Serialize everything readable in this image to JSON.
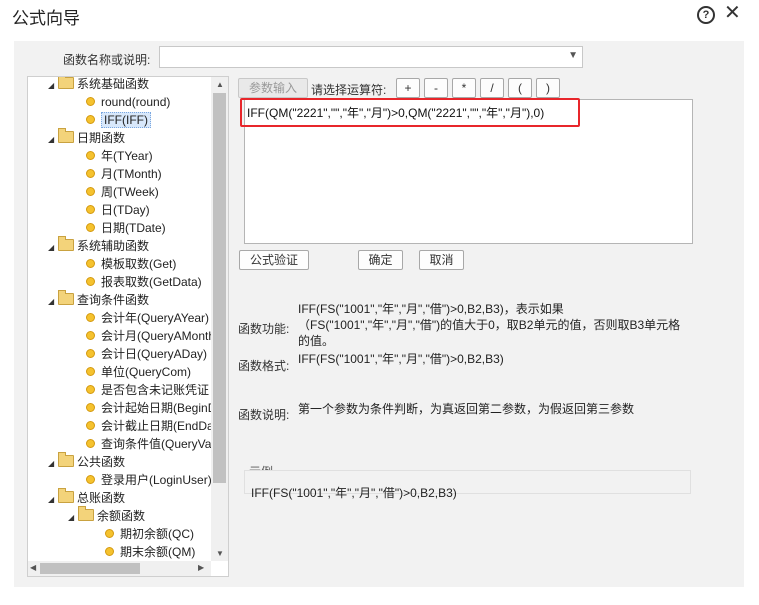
{
  "window": {
    "title": "公式向导",
    "help_icon": "question-circle-icon",
    "close_icon": "close-x-icon"
  },
  "function_select": {
    "label": "函数名称或说明:",
    "value": ""
  },
  "tree": [
    {
      "type": "folder",
      "label": "系统基础函数"
    },
    {
      "type": "leaf",
      "label": "round(round)"
    },
    {
      "type": "leaf",
      "label": "IFF(IFF)",
      "selected": true
    },
    {
      "type": "folder",
      "label": "日期函数"
    },
    {
      "type": "leaf",
      "label": "年(TYear)"
    },
    {
      "type": "leaf",
      "label": "月(TMonth)"
    },
    {
      "type": "leaf",
      "label": "周(TWeek)"
    },
    {
      "type": "leaf",
      "label": "日(TDay)"
    },
    {
      "type": "leaf",
      "label": "日期(TDate)"
    },
    {
      "type": "folder",
      "label": "系统辅助函数"
    },
    {
      "type": "leaf",
      "label": "模板取数(Get)"
    },
    {
      "type": "leaf",
      "label": "报表取数(GetData)"
    },
    {
      "type": "folder",
      "label": "查询条件函数"
    },
    {
      "type": "leaf",
      "label": "会计年(QueryAYear)"
    },
    {
      "type": "leaf",
      "label": "会计月(QueryAMonth)"
    },
    {
      "type": "leaf",
      "label": "会计日(QueryADay)"
    },
    {
      "type": "leaf",
      "label": "单位(QueryCom)"
    },
    {
      "type": "leaf",
      "label": "是否包含未记账凭证"
    },
    {
      "type": "leaf",
      "label": "会计起始日期(BeginDate)"
    },
    {
      "type": "leaf",
      "label": "会计截止日期(EndDate)"
    },
    {
      "type": "leaf",
      "label": "查询条件值(QueryValue)"
    },
    {
      "type": "folder",
      "label": "公共函数"
    },
    {
      "type": "leaf",
      "label": "登录用户(LoginUser)"
    },
    {
      "type": "folder",
      "label": "总账函数"
    },
    {
      "type": "folder2",
      "label": "余额函数"
    },
    {
      "type": "leaf2",
      "label": "期初余额(QC)"
    },
    {
      "type": "leaf2",
      "label": "期末余额(QM)"
    }
  ],
  "toolbar": {
    "param_input": "参数输入",
    "op_label": "请选择运算符:",
    "operators": [
      "+",
      "-",
      "*",
      "/",
      "(",
      ")"
    ]
  },
  "editor": {
    "formula": "IFF(QM(\"2221\",\"\",\"年\",\"月\")>0,QM(\"2221\",\"\",\"年\",\"月\"),0)"
  },
  "actions": {
    "verify": "公式验证",
    "ok": "确定",
    "cancel": "取消"
  },
  "info": {
    "func_label": "函数功能:",
    "func_text": "IFF(FS(\"1001\",\"年\",\"月\",\"借\")>0,B2,B3)，表示如果（FS(\"1001\",\"年\",\"月\",\"借\")的值大于0，取B2单元的值，否则取B3单元格的值。",
    "format_label": "函数格式:",
    "format_text": "IFF(FS(\"1001\",\"年\",\"月\",\"借\")>0,B2,B3)",
    "desc_label": "函数说明:",
    "desc_text": "第一个参数为条件判断，为真返回第二参数，为假返回第三参数",
    "example_label": "示例",
    "example_text": "IFF(FS(\"1001\",\"年\",\"月\",\"借\")>0,B2,B3)"
  },
  "colors": {
    "highlight": "#e8262b",
    "panel": "#f2f2f2",
    "selected": "#d8e8fb"
  }
}
